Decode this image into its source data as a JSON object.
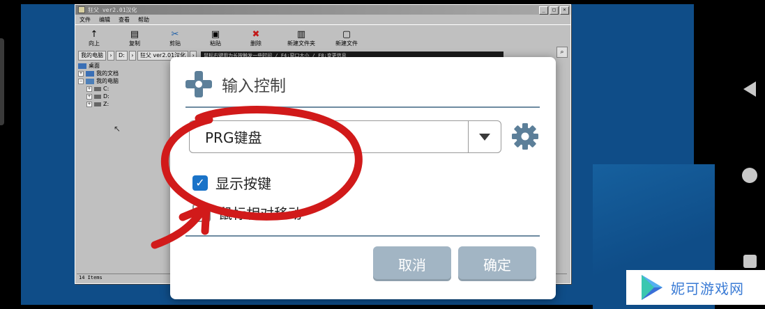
{
  "window": {
    "title": "狂父 ver2.01汉化",
    "controls": [
      "_",
      "□",
      "×"
    ],
    "menu": [
      "文件",
      "编辑",
      "查看",
      "帮助"
    ],
    "toolbar": [
      {
        "icon": "up-arrow-icon",
        "glyph": "↑",
        "label": "向上"
      },
      {
        "icon": "copy-icon",
        "glyph": "▤",
        "label": "复制"
      },
      {
        "icon": "cut-icon",
        "glyph": "✂",
        "label": "剪贴"
      },
      {
        "icon": "paste-icon",
        "glyph": "▣",
        "label": "粘贴"
      },
      {
        "icon": "delete-icon",
        "glyph": "✖",
        "label": "删除"
      },
      {
        "icon": "new-folder-icon",
        "glyph": "▥",
        "label": "新建文件夹"
      },
      {
        "icon": "new-file-icon",
        "glyph": "▢",
        "label": "新建文件"
      }
    ],
    "breadcrumbs": [
      "我的电脑",
      "D:",
      "狂父 ver2.01汉化"
    ],
    "marquee": "鼠标右键用为长按触发一些时间 / F4:窗口大小 / F8:变更信息",
    "tree": [
      {
        "label": "桌面",
        "type": "folder",
        "level": 0
      },
      {
        "label": "我的文档",
        "type": "folder",
        "level": 0
      },
      {
        "label": "我的电脑",
        "type": "computer",
        "level": 0
      },
      {
        "label": "C:",
        "type": "drive",
        "level": 1
      },
      {
        "label": "D:",
        "type": "drive",
        "level": 1
      },
      {
        "label": "Z:",
        "type": "drive",
        "level": 1
      }
    ],
    "status": "14 Items"
  },
  "dialog": {
    "title": "输入控制",
    "selected_layout": "PRG键盘",
    "checkboxes": [
      {
        "label": "显示按键",
        "checked": true
      },
      {
        "label": "鼠标相对移动",
        "checked": false
      }
    ],
    "cancel_label": "取消",
    "ok_label": "确定",
    "accent_color": "#1a73c8",
    "button_color": "#a2b5c4"
  },
  "watermark": {
    "text": "妮可游戏网"
  },
  "annotation_color": "#d11a1a"
}
